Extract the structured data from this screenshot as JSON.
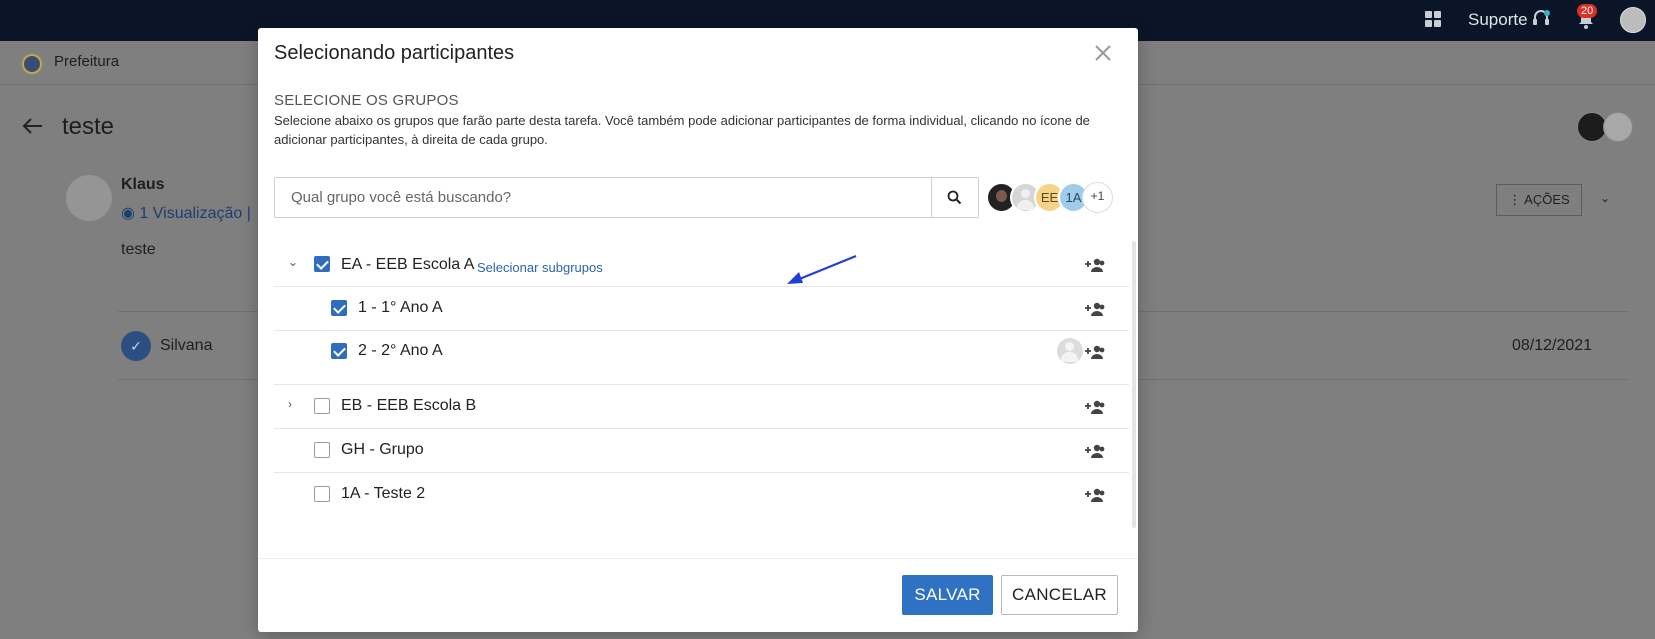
{
  "topbar": {
    "support_label": "Suporte",
    "notification_count": "20"
  },
  "background": {
    "breadcrumb": "Prefeitura",
    "title": "teste",
    "author": "Klaus",
    "views": "1 Visualização  |",
    "body_text": "teste",
    "assignee": "Silvana",
    "date": "08/12/2021",
    "actions_label": "⋮  AÇÕES"
  },
  "modal": {
    "title": "Selecionando participantes",
    "section_title": "SELECIONE OS GRUPOS",
    "section_desc": "Selecione abaixo os grupos que farão parte desta tarefa. Você também pode adicionar participantes de forma individual, clicando no ícone de adicionar participantes, à direita de cada grupo.",
    "search": {
      "placeholder": "Qual grupo você está buscando?",
      "value": ""
    },
    "selected_avatars": {
      "ee": "EE",
      "a1": "1A",
      "more": "+1"
    },
    "groups": [
      {
        "label": "EA - EEB Escola A",
        "checked": true,
        "expanded": true,
        "sub_link": "Selecionar subgrupos"
      },
      {
        "label": "1 - 1° Ano A",
        "checked": true
      },
      {
        "label": "2 - 2° Ano A",
        "checked": true
      },
      {
        "label": "EB - EEB Escola B",
        "checked": false,
        "expanded": false
      },
      {
        "label": "GH - Grupo",
        "checked": false
      },
      {
        "label": "1A - Teste 2",
        "checked": false
      }
    ],
    "save_label": "SALVAR",
    "cancel_label": "CANCELAR"
  },
  "colors": {
    "primary": "#2f72c4",
    "link": "#2b64b3",
    "annotation_arrow": "#1f3fd6",
    "topbar": "#0a1628"
  }
}
